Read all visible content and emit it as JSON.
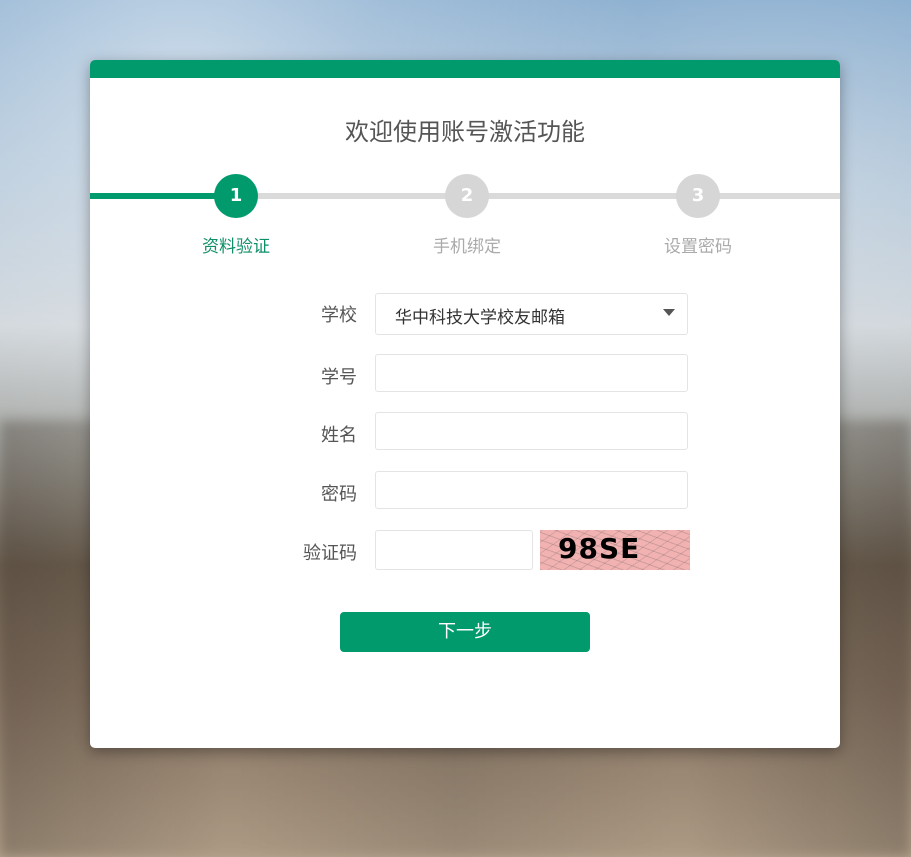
{
  "title": "欢迎使用账号激活功能",
  "steps": [
    {
      "number": "1",
      "label": "资料验证",
      "state": "active"
    },
    {
      "number": "2",
      "label": "手机绑定",
      "state": "inactive"
    },
    {
      "number": "3",
      "label": "设置密码",
      "state": "inactive"
    }
  ],
  "form": {
    "school_label": "学校",
    "school_value": "华中科技大学校友邮箱",
    "student_id_label": "学号",
    "student_id_value": "",
    "name_label": "姓名",
    "name_value": "",
    "password_label": "密码",
    "password_value": "",
    "captcha_label": "验证码",
    "captcha_value": "",
    "captcha_image_text": "98SE"
  },
  "next_button": "下一步",
  "colors": {
    "accent": "#009a6d",
    "inactive": "#d6d6d6"
  },
  "icons": {
    "dropdown": "chevron-down-icon"
  }
}
